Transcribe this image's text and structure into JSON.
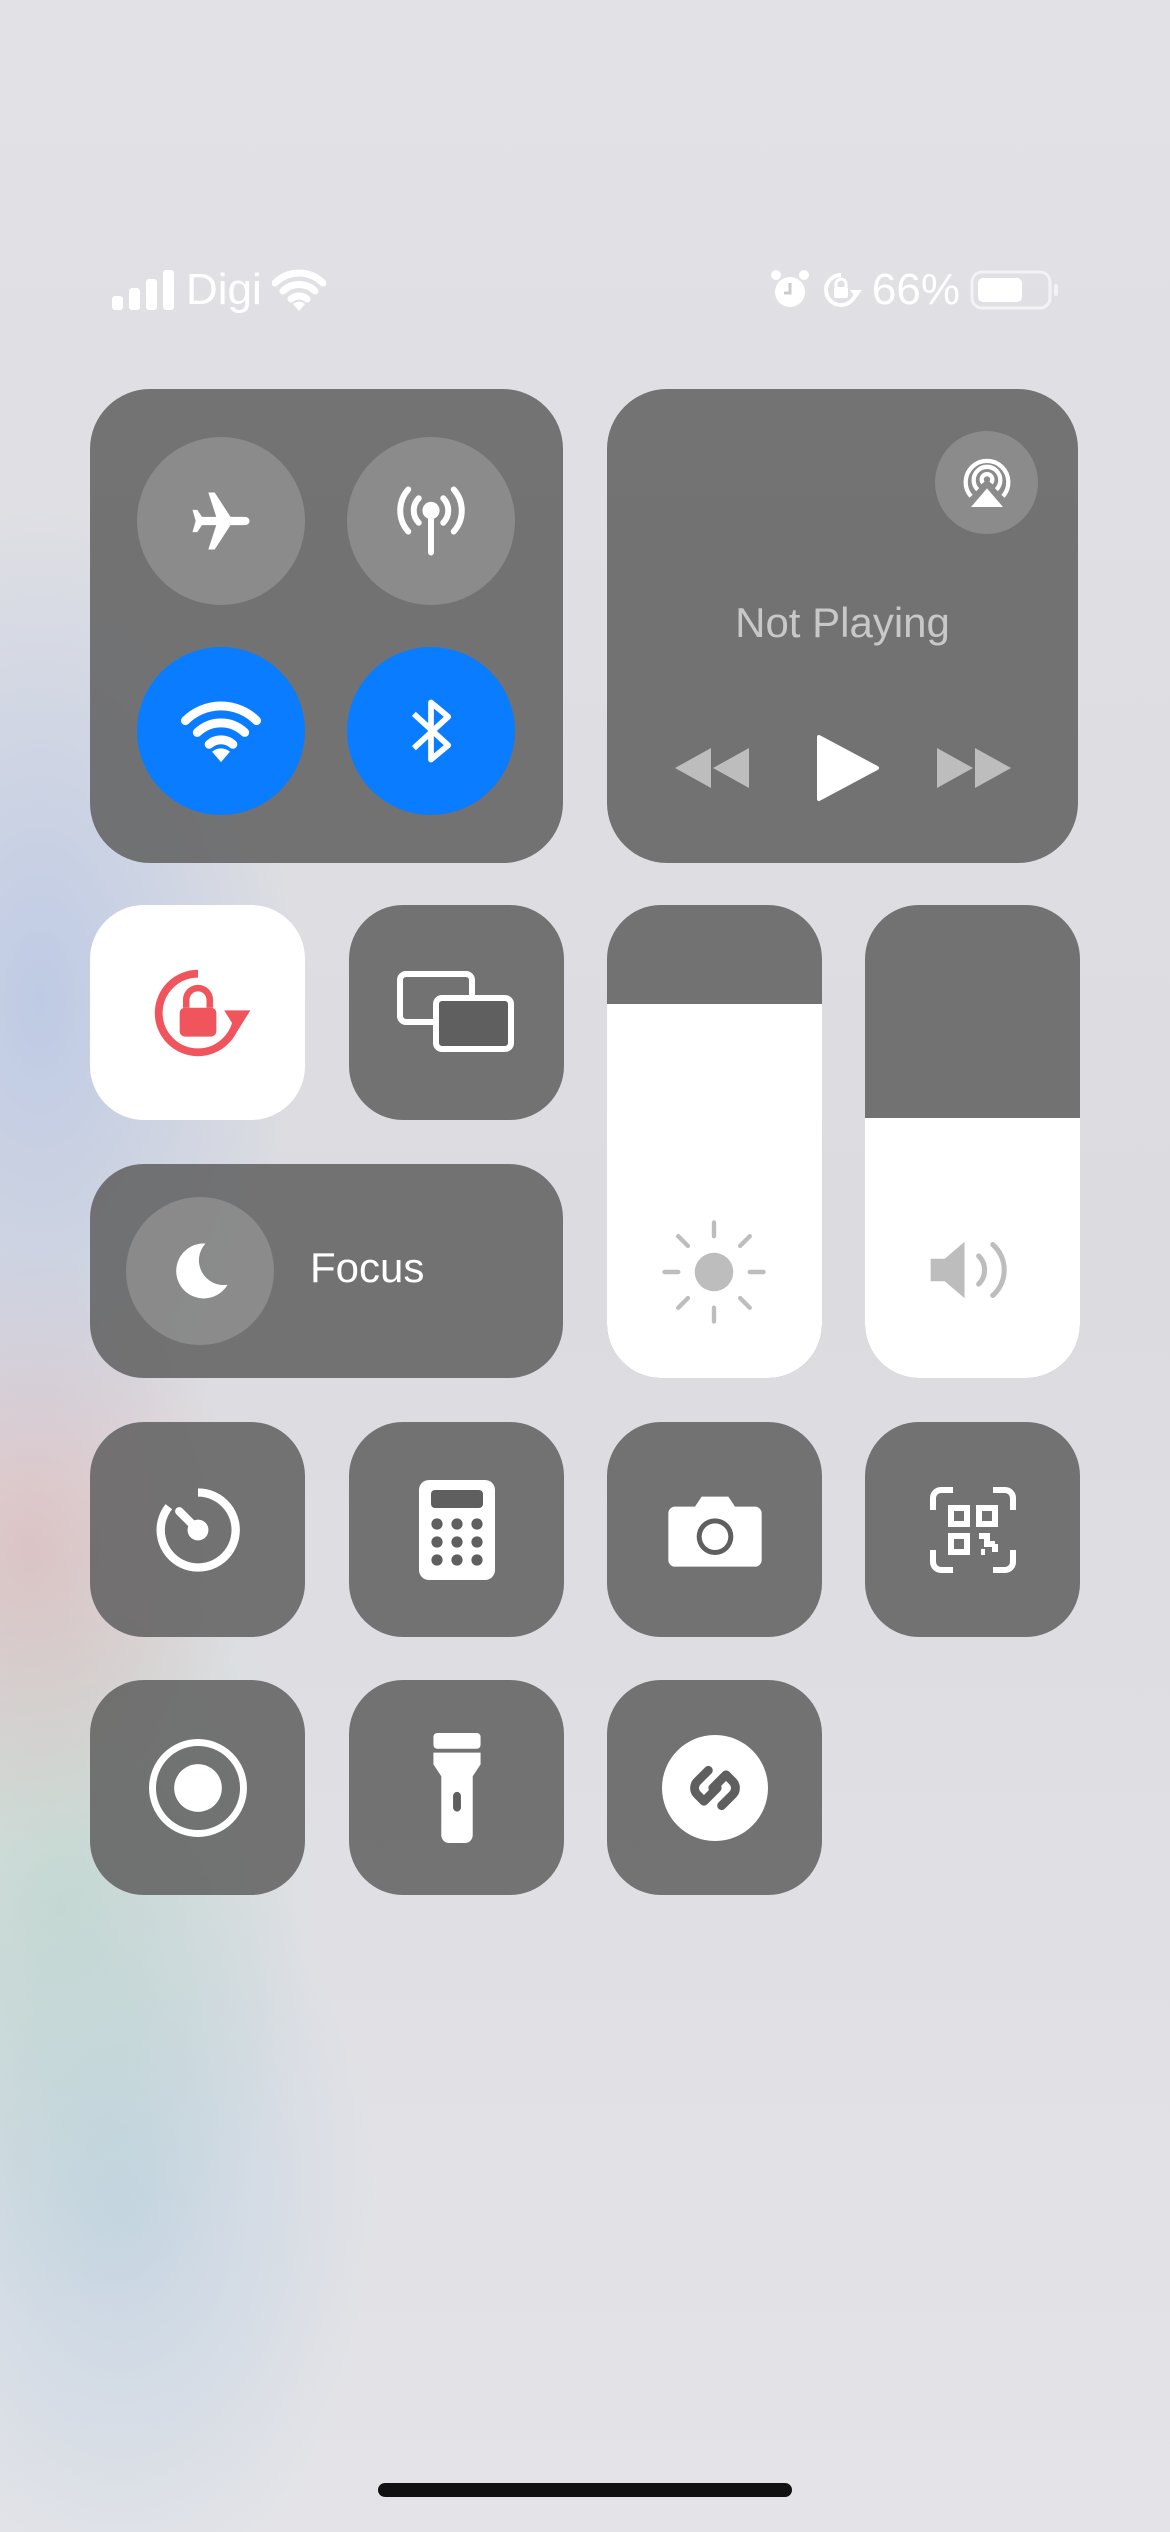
{
  "status_bar": {
    "carrier": "Digi",
    "battery_percent": "66%",
    "battery_level": 0.66,
    "icons": [
      "cellular-signal-icon",
      "wifi-icon",
      "alarm-icon",
      "orientation-lock-icon",
      "battery-icon"
    ]
  },
  "connectivity": {
    "airplane_mode": false,
    "cellular_data": false,
    "wifi": true,
    "bluetooth": true,
    "active_color": "#0a7cff"
  },
  "media": {
    "status": "Not Playing"
  },
  "orientation_lock": {
    "enabled": true,
    "color": "#f0545c"
  },
  "focus": {
    "label": "Focus"
  },
  "brightness": {
    "level": 0.79
  },
  "volume": {
    "level": 0.55
  },
  "controls": [
    "timer",
    "calculator",
    "camera",
    "code-scanner",
    "screen-recording",
    "flashlight",
    "shazam"
  ]
}
